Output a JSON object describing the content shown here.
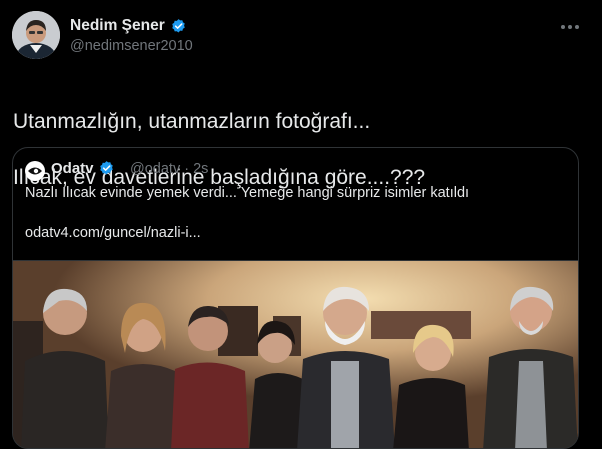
{
  "tweet": {
    "author_name": "Nedim Şener",
    "handle": "@nedimsener2010",
    "text_line1": "Utanmazlığın, utanmazların fotoğrafı...",
    "text_line2": "Ilıcak, ev davetlerine başladığına göre....???"
  },
  "quote": {
    "author_name": "Odatv",
    "handle": "@odatv",
    "time": "· 2s",
    "text": "Nazlı Ilıcak evinde yemek verdi... Yemeğe hangi sürpriz isimler katıldı",
    "link": "odatv4.com/guncel/nazli-i..."
  },
  "icons": {
    "verified": "verified-badge-icon",
    "more": "more-options-icon"
  },
  "colors": {
    "background": "#000000",
    "text": "#e7e9ea",
    "muted": "#71767b",
    "verified": "#1d9bf0",
    "border": "#2f3336"
  }
}
